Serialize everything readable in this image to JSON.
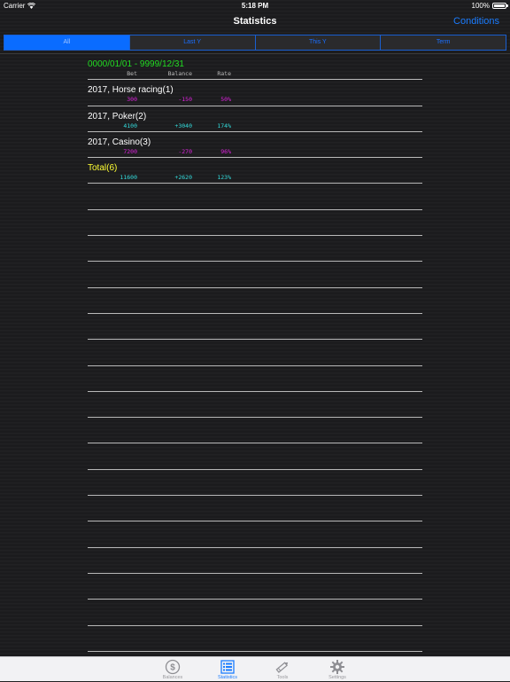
{
  "status_bar": {
    "carrier": "Carrier",
    "time": "5:18 PM",
    "battery": "100%",
    "battery_level": 1.0
  },
  "nav": {
    "title": "Statistics",
    "conditions_label": "Conditions"
  },
  "segments": [
    {
      "label": "All",
      "selected": true
    },
    {
      "label": "Last Y",
      "selected": false
    },
    {
      "label": "This Y",
      "selected": false
    },
    {
      "label": "Term",
      "selected": false
    }
  ],
  "stats": {
    "range": "0000/01/01 - 9999/12/31",
    "headers": {
      "bet": "Bet",
      "balance": "Balance",
      "rate": "Rate"
    },
    "rows": [
      {
        "label": "2017, Horse racing(1)",
        "bet": "300",
        "balance": "-150",
        "rate": "50%"
      },
      {
        "label": "2017, Poker(2)",
        "bet": "4100",
        "balance": "+3040",
        "rate": "174%"
      },
      {
        "label": "2017, Casino(3)",
        "bet": "7200",
        "balance": "-270",
        "rate": "96%"
      }
    ],
    "total": {
      "label": "Total(6)",
      "bet": "11600",
      "balance": "+2620",
      "rate": "123%"
    }
  },
  "colors": {
    "range_text": "#22dd22",
    "header_text": "#bbbbbb",
    "row_text": "#ffffff",
    "total_text": "#ffff33",
    "negative": "#dd22dd",
    "positive": "#33dddd",
    "accent": "#1a7cff"
  },
  "tabs": [
    {
      "label": "Balances",
      "icon": "dollar-icon",
      "active": false
    },
    {
      "label": "Statistics",
      "icon": "list-icon",
      "active": true
    },
    {
      "label": "Tools",
      "icon": "pencil-icon",
      "active": false
    },
    {
      "label": "Settings",
      "icon": "gear-icon",
      "active": false
    }
  ]
}
